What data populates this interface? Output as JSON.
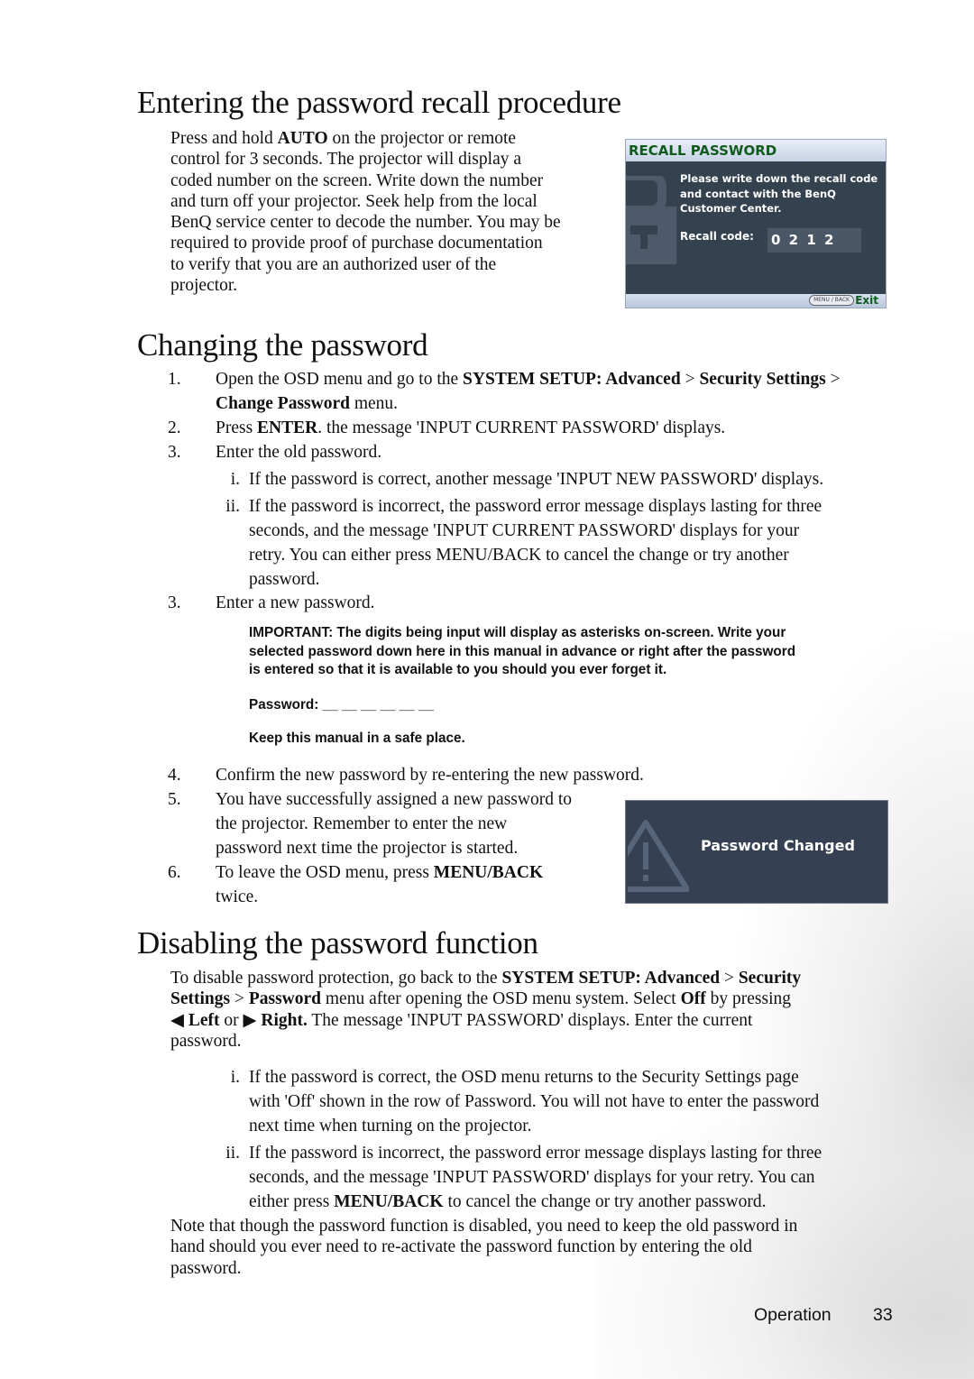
{
  "sections": {
    "recall": {
      "title": "Entering the password recall procedure",
      "lines": [
        [
          "Press and hold ",
          {
            "b": "AUTO"
          },
          " on the projector or remote"
        ],
        [
          "control for 3 seconds. The projector will display a"
        ],
        [
          "coded number on the screen. Write down the number"
        ],
        [
          "and turn off your projector. Seek help from the local"
        ],
        [
          "BenQ service center to decode the number. You may be"
        ],
        [
          "required to provide proof of purchase documentation"
        ],
        [
          "to verify that you are an authorized user of the"
        ],
        [
          "projector."
        ]
      ],
      "osd": {
        "header": "RECALL PASSWORD",
        "message_lines": [
          "Please write down the recall code",
          "and contact with the BenQ",
          "Customer Center."
        ],
        "recall_code_label": "Recall code:",
        "recall_code": "0 2 1 2",
        "menu_back_key": "MENU / BACK",
        "exit_label": "Exit"
      }
    },
    "change": {
      "title": "Changing the password",
      "steps": [
        {
          "num": "1.",
          "lines": [
            [
              "Open the OSD menu and go to the ",
              {
                "b": "SYSTEM SETUP: Advanced"
              },
              " > ",
              {
                "b": "Security Settings"
              },
              " >"
            ],
            [
              {
                "b": "Change Password"
              },
              " menu."
            ]
          ]
        },
        {
          "num": "2.",
          "lines": [
            [
              "Press ",
              {
                "b": "ENTER"
              },
              ". the message 'INPUT CURRENT PASSWORD' displays."
            ]
          ]
        },
        {
          "num": "3.",
          "lines": [
            [
              "Enter the old password."
            ]
          ]
        }
      ],
      "substeps": [
        {
          "num": "i.",
          "lines": [
            [
              "If the password is correct, another message 'INPUT NEW PASSWORD' displays."
            ]
          ]
        },
        {
          "num": "ii.",
          "lines": [
            [
              "If the password is incorrect, the password error message displays lasting for three"
            ],
            [
              "seconds, and the message 'INPUT CURRENT PASSWORD' displays for your"
            ],
            [
              "retry. You can either press MENU/BACK to cancel the change or try another"
            ],
            [
              "password."
            ]
          ]
        }
      ],
      "step3b": {
        "num": "3.",
        "text": "Enter a new password."
      },
      "important": {
        "lines": [
          "IMPORTANT: The digits being input will display as asterisks on-screen. Write your",
          "selected password down here in this manual in advance or right after the password",
          "is entered so that it is available to you should you ever forget it."
        ],
        "password_label": "Password:",
        "password_blanks": "__ __ __ __ __ __",
        "keep_note": "Keep this manual in a safe place."
      },
      "steps_after": [
        {
          "num": "4.",
          "lines": [
            [
              "Confirm the new password by re-entering the new password."
            ]
          ]
        },
        {
          "num": "5.",
          "lines": [
            [
              "You have successfully assigned a new password to"
            ],
            [
              "the projector. Remember to enter the new"
            ],
            [
              "password next time the projector is started."
            ]
          ]
        },
        {
          "num": "6.",
          "lines": [
            [
              "To leave the OSD menu, press ",
              {
                "b": "MENU/BACK"
              }
            ],
            [
              "twice."
            ]
          ]
        }
      ],
      "osd": {
        "message": "Password Changed",
        "icon": "warning-triangle-icon"
      }
    },
    "disable": {
      "title": "Disabling the password function",
      "intro_lines": [
        [
          "To disable password protection, go back to the ",
          {
            "b": "SYSTEM SETUP: Advanced"
          },
          " > ",
          {
            "b": "Security"
          }
        ],
        [
          {
            "b": "Settings"
          },
          " > ",
          {
            "b": "Password"
          },
          " menu after opening the OSD menu system. Select ",
          {
            "b": "Off"
          },
          " by pressing"
        ],
        [
          {
            "b": "◀ Left"
          },
          " or ",
          {
            "b": "▶ Right."
          },
          " The message 'INPUT PASSWORD' displays. Enter the current"
        ],
        [
          "password."
        ]
      ],
      "substeps": [
        {
          "num": "i.",
          "lines": [
            [
              "If the password is correct, the OSD menu returns to the Security Settings page"
            ],
            [
              "with 'Off' shown in the row of Password. You will not have to enter the password"
            ],
            [
              "next time when turning on the projector."
            ]
          ]
        },
        {
          "num": "ii.",
          "lines": [
            [
              "If the password is incorrect, the password error message displays lasting for three"
            ],
            [
              "seconds, and the message 'INPUT PASSWORD' displays for your retry. You can"
            ],
            [
              "either press ",
              {
                "b": "MENU/BACK"
              },
              " to cancel the change or try another password."
            ]
          ]
        }
      ],
      "note_lines": [
        [
          "Note that though the password function is disabled, you need to keep the old password in"
        ],
        [
          "hand should you ever need to re-activate the password function by entering the old"
        ],
        [
          "password."
        ]
      ]
    }
  },
  "footer": {
    "section": "Operation",
    "page": "33"
  }
}
